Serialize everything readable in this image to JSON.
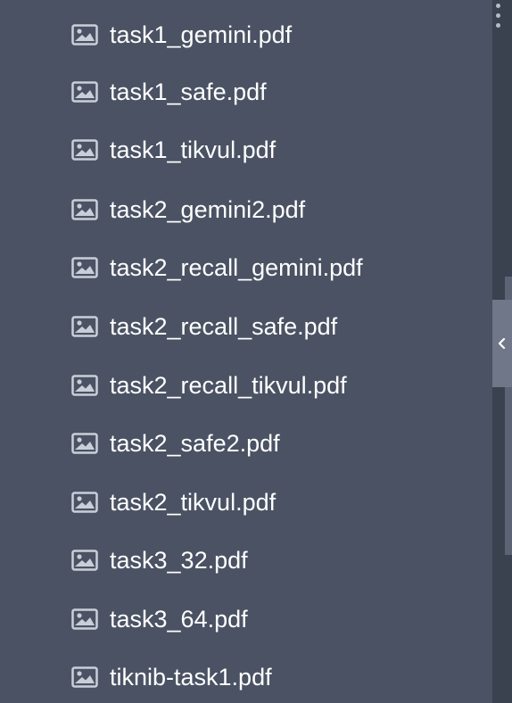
{
  "files": [
    {
      "name": "task1_gemini.pdf",
      "icon": "image-icon"
    },
    {
      "name": "task1_safe.pdf",
      "icon": "image-icon"
    },
    {
      "name": "task1_tikvul.pdf",
      "icon": "image-icon"
    },
    {
      "name": "task2_gemini2.pdf",
      "icon": "image-icon"
    },
    {
      "name": "task2_recall_gemini.pdf",
      "icon": "image-icon"
    },
    {
      "name": "task2_recall_safe.pdf",
      "icon": "image-icon"
    },
    {
      "name": "task2_recall_tikvul.pdf",
      "icon": "image-icon"
    },
    {
      "name": "task2_safe2.pdf",
      "icon": "image-icon"
    },
    {
      "name": "task2_tikvul.pdf",
      "icon": "image-icon"
    },
    {
      "name": "task3_32.pdf",
      "icon": "image-icon"
    },
    {
      "name": "task3_64.pdf",
      "icon": "image-icon"
    },
    {
      "name": "tiknib-task1.pdf",
      "icon": "image-icon"
    }
  ],
  "colors": {
    "background": "#4a5263",
    "text": "#ffffff",
    "icon": "#c9cfd9",
    "side_strip": "#3a414f",
    "collapse_tab": "#6f7789"
  },
  "collapse_icon": "chevron-left-icon",
  "menu_icon": "vertical-dots-icon"
}
